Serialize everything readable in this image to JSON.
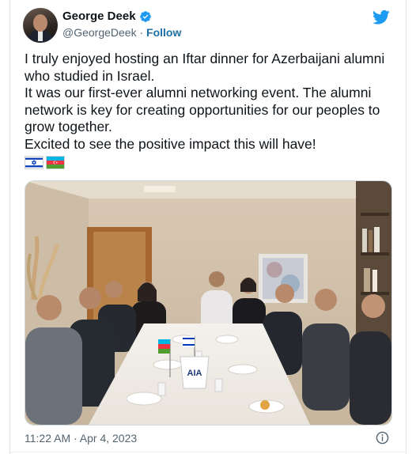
{
  "author": {
    "name": "George Deek",
    "handle": "@GeorgeDeek",
    "separator": " · ",
    "follow_label": "Follow",
    "verified": true
  },
  "tweet": {
    "lines": [
      "I truly enjoyed hosting an Iftar dinner for Azerbaijani alumni who studied in Israel.",
      "It was our first-ever alumni networking event. The alumni network is key for creating opportunities for our peoples to grow together.",
      "Excited to see the positive impact this will have!"
    ],
    "flags": [
      "israel-flag",
      "azerbaijan-flag"
    ]
  },
  "meta": {
    "timestamp": "11:22 AM · Apr 4, 2023"
  },
  "photo": {
    "sign_text": "AIA"
  },
  "colors": {
    "twitter_blue": "#1d9bf0",
    "follow_blue": "#1d6fa5",
    "muted_text": "#536471"
  },
  "icons": {
    "logo": "twitter-bird-icon",
    "verified": "verified-badge-icon",
    "info": "info-icon"
  }
}
